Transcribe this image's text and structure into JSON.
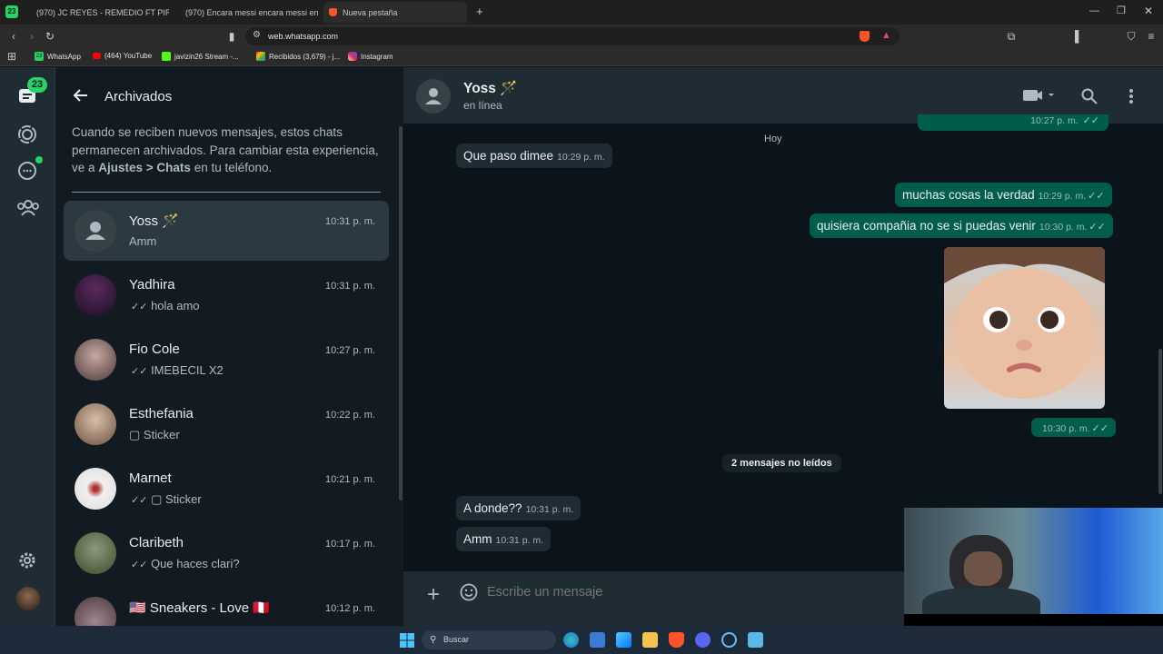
{
  "browser": {
    "tab_badge": "23",
    "tabs": [
      {
        "label": "(970) JC REYES - REMEDIO FT PIRLO"
      },
      {
        "label": "(970) Encara messi encara messi enc"
      },
      {
        "label": "Nueva pestaña"
      }
    ],
    "new_tab": "+",
    "url": "web.whatsapp.com",
    "bookmarks": [
      {
        "label": "WhatsApp",
        "badge": "23"
      },
      {
        "label": "(464) YouTube"
      },
      {
        "label": "javizin26 Stream -..."
      },
      {
        "label": "Recibidos (3,679) - j..."
      },
      {
        "label": "Instagram"
      }
    ]
  },
  "rail": {
    "chats_badge": "23"
  },
  "archive": {
    "title": "Archivados",
    "info_pre": "Cuando se reciben nuevos mensajes, estos chats permanecen archivados. Para cambiar esta experiencia, ve a ",
    "info_bold": "Ajustes > Chats",
    "info_post": " en tu teléfono.",
    "items": [
      {
        "name": "Yoss 🪄",
        "time": "10:31 p. m.",
        "message": "Amm",
        "checks": ""
      },
      {
        "name": "Yadhira",
        "time": "10:31 p. m.",
        "message": "hola amo",
        "checks": "✓✓"
      },
      {
        "name": "Fio Cole",
        "time": "10:27 p. m.",
        "message": "IMEBECIL X2",
        "checks": "✓✓"
      },
      {
        "name": "Esthefania",
        "time": "10:22 p. m.",
        "message": "Sticker",
        "checks": ""
      },
      {
        "name": "Marnet",
        "time": "10:21 p. m.",
        "message": "Sticker",
        "checks": "✓✓"
      },
      {
        "name": "Claribeth",
        "time": "10:17 p. m.",
        "message": "Que haces clari?",
        "checks": "✓✓"
      },
      {
        "name": "🇺🇸 Sneakers  - Love  🇵🇪",
        "time": "10:12 p. m.",
        "message": "",
        "checks": ""
      }
    ]
  },
  "chat": {
    "contact_name": "Yoss 🪄",
    "status": "en línea",
    "partial_time": "10:27 p. m.",
    "date_separator": "Hoy",
    "messages": [
      {
        "text": "Que paso dimee",
        "time": "10:29 p. m."
      },
      {
        "text": "muchas cosas la verdad",
        "time": "10:29 p. m."
      },
      {
        "text": "quisiera compañia no se si puedas venir",
        "time": "10:30 p. m."
      },
      {
        "text": "",
        "time": "10:30 p. m."
      },
      {
        "text": "A donde??",
        "time": "10:31 p. m."
      },
      {
        "text": "Amm",
        "time": "10:31 p. m."
      }
    ],
    "unread_label": "2 mensajes no leídos",
    "composer_placeholder": "Escribe un mensaje"
  },
  "taskbar": {
    "search_label": "Buscar"
  },
  "colors": {
    "accent": "#25d366",
    "outgoing": "#005c4b",
    "incoming": "#202c33",
    "panel": "#111b21"
  }
}
